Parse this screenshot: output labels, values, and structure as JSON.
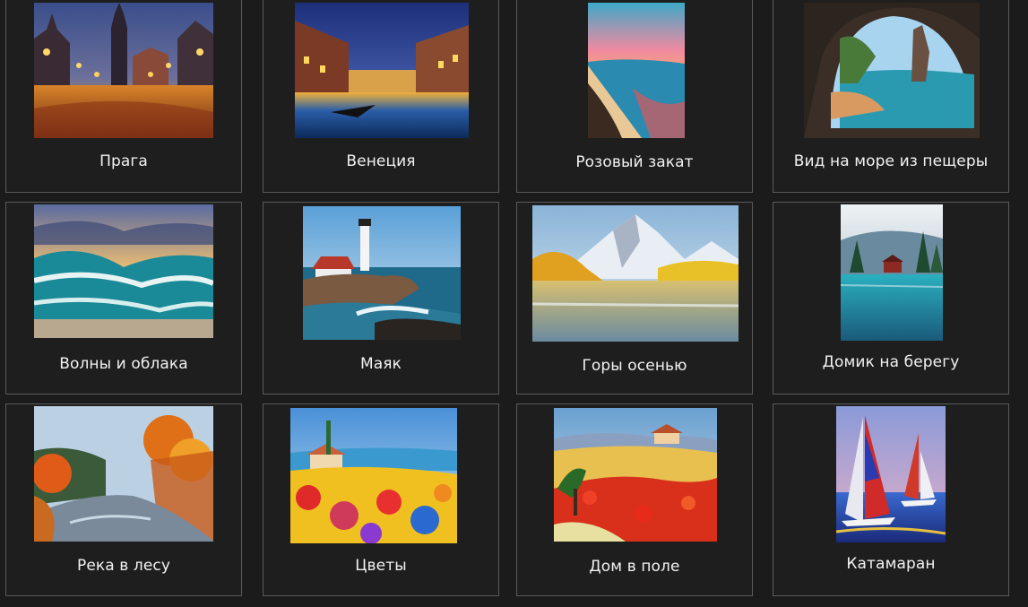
{
  "gallery": {
    "items": [
      {
        "title": "Прага",
        "icon": "prague-painting"
      },
      {
        "title": "Венеция",
        "icon": "venice-painting"
      },
      {
        "title": "Розовый закат",
        "icon": "pink-sunset-painting"
      },
      {
        "title": "Вид на море из пещеры",
        "icon": "sea-cave-painting"
      },
      {
        "title": "Волны и облака",
        "icon": "waves-clouds-painting"
      },
      {
        "title": "Маяк",
        "icon": "lighthouse-painting"
      },
      {
        "title": "Горы осенью",
        "icon": "autumn-mountains-painting"
      },
      {
        "title": "Домик на берегу",
        "icon": "lakeside-house-painting"
      },
      {
        "title": "Река в лесу",
        "icon": "forest-river-painting"
      },
      {
        "title": "Цветы",
        "icon": "flowers-painting"
      },
      {
        "title": "Дом в поле",
        "icon": "field-house-painting"
      },
      {
        "title": "Катамаран",
        "icon": "catamaran-painting"
      }
    ]
  }
}
